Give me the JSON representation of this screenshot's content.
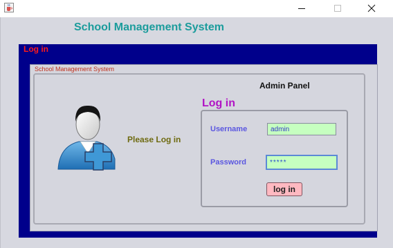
{
  "window": {
    "icon": "java-cup-icon",
    "controls": [
      "minimize-icon",
      "maximize-icon",
      "close-icon"
    ]
  },
  "system_title": "School Management System",
  "blue_panel_title": "Log in",
  "inner_panel_title": "School Management System",
  "admin_panel": "Admin Panel",
  "avatar_icon": "user-add-icon",
  "please_login": "Please Log in",
  "login_form": {
    "heading": "Log in",
    "username_label": "Username",
    "username_value": "admin",
    "password_label": "Password",
    "password_value": "*****",
    "submit_label": "log in"
  },
  "colors": {
    "frame_background": "#d7d8e0",
    "blue_panel": "#00008b",
    "system_title": "#1b9c9c",
    "blue_panel_title": "#ff1a1a",
    "login_heading": "#b113c5",
    "field_label": "#5a56e0",
    "field_background": "#c6ffc0",
    "login_button": "#ffb9c1"
  }
}
